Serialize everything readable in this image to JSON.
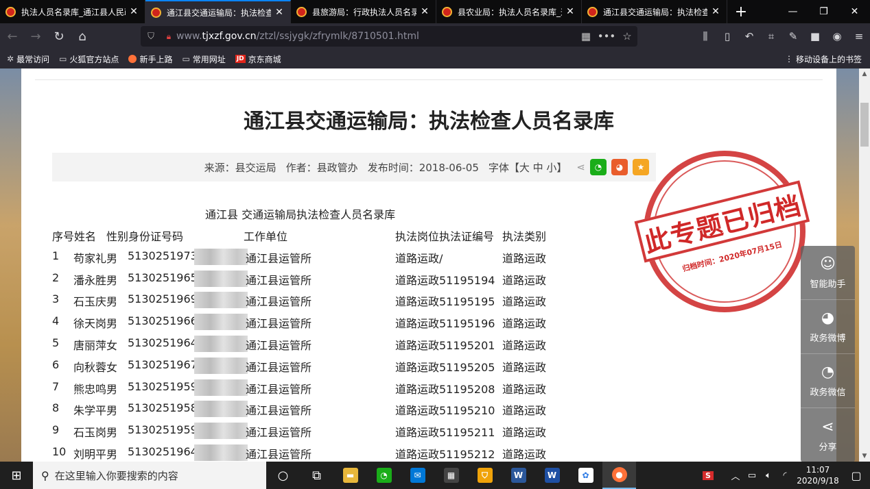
{
  "browser": {
    "tabs": [
      {
        "title": "执法人员名录库_通江县人民政府",
        "active": false
      },
      {
        "title": "通江县交通运输局：执法检查人员名录库",
        "active": true
      },
      {
        "title": "县旅游局：行政执法人员名录库",
        "active": false
      },
      {
        "title": "县农业局：执法人员名录库_通江县人民政府",
        "active": false
      },
      {
        "title": "通江县交通运输局：执法检查人员名录库",
        "active": false
      }
    ],
    "new_tab": "+",
    "window_controls": {
      "minimize": "—",
      "restore": "❐",
      "close": "✕"
    },
    "url": {
      "prefix": "www.",
      "domain": "tjxzf.gov.cn",
      "path": "/ztzl/ssjygk/zfrymlk/8710501.html"
    },
    "nav": {
      "back": "←",
      "forward": "→",
      "reload": "↻",
      "home": "⌂"
    },
    "bookmarks": [
      {
        "label": "最常访问",
        "icon": "gear-icon"
      },
      {
        "label": "火狐官方站点",
        "icon": "folder-icon"
      },
      {
        "label": "新手上路",
        "icon": "firefox-icon"
      },
      {
        "label": "常用网址",
        "icon": "folder-icon"
      },
      {
        "label": "京东商城",
        "icon": "jd-icon"
      }
    ],
    "mobile_bookmarks": "移动设备上的书签"
  },
  "article": {
    "title": "通江县交通运输局：执法检查人员名录库",
    "meta": {
      "source": "来源：县交运局",
      "author": "作者：县政管办",
      "date": "发布时间：2018-06-05",
      "font": "字体【大 中 小】"
    },
    "doc_title": "通江县 交通运输局执法检查人员名录库",
    "table_headers": [
      "序号姓名",
      "性别身份证号码",
      "工作单位",
      "执法岗位执法证编号",
      "执法类别"
    ],
    "rows": [
      {
        "no": "1",
        "name": "苟家礼男",
        "id": "5130251973",
        "unit": "通江县运管所",
        "post": "道路运政/",
        "type": "道路运政"
      },
      {
        "no": "2",
        "name": "潘永胜男",
        "id": "5130251965",
        "unit": "通江县运管所",
        "post": "道路运政51195194",
        "type": "道路运政"
      },
      {
        "no": "3",
        "name": "石玉庆男",
        "id": "5130251969",
        "unit": "通江县运管所",
        "post": "道路运政51195195",
        "type": "道路运政"
      },
      {
        "no": "4",
        "name": "徐天岗男",
        "id": "5130251966",
        "unit": "通江县运管所",
        "post": "道路运政51195196",
        "type": "道路运政"
      },
      {
        "no": "5",
        "name": "唐丽萍女",
        "id": "5130251964",
        "unit": "通江县运管所",
        "post": "道路运政51195201",
        "type": "道路运政"
      },
      {
        "no": "6",
        "name": "向秋蓉女",
        "id": "5130251967",
        "unit": "通江县运管所",
        "post": "道路运政51195205",
        "type": "道路运政"
      },
      {
        "no": "7",
        "name": "熊忠鸣男",
        "id": "5130251959",
        "unit": "通江县运管所",
        "post": "道路运政51195208",
        "type": "道路运政"
      },
      {
        "no": "8",
        "name": "朱学平男",
        "id": "5130251958",
        "unit": "通江县运管所",
        "post": "道路运政51195210",
        "type": "道路运政"
      },
      {
        "no": "9",
        "name": "石玉岗男",
        "id": "5130251959",
        "unit": "通江县运管所",
        "post": "道路运政51195211",
        "type": "道路运政"
      },
      {
        "no": "10",
        "name": "刘明平男",
        "id": "5130251964",
        "unit": "通江县运管所",
        "post": "道路运政51195212",
        "type": "道路运政"
      }
    ],
    "stamp": {
      "main": "此专题已归档",
      "date": "归档时间：2020年07月15日"
    }
  },
  "float_panel": [
    {
      "label": "智能助手",
      "icon": "robot-icon"
    },
    {
      "label": "政务微博",
      "icon": "weibo-icon"
    },
    {
      "label": "政务微信",
      "icon": "wechat-icon"
    },
    {
      "label": "分享",
      "icon": "share-icon"
    }
  ],
  "taskbar": {
    "search_placeholder": "在这里输入你要搜索的内容",
    "time": "11:07",
    "date": "2020/9/18"
  },
  "colors": {
    "accent": "#0a84ff",
    "stamp": "#d02828",
    "wechat": "#1aad19",
    "weibo": "#e6162d"
  }
}
